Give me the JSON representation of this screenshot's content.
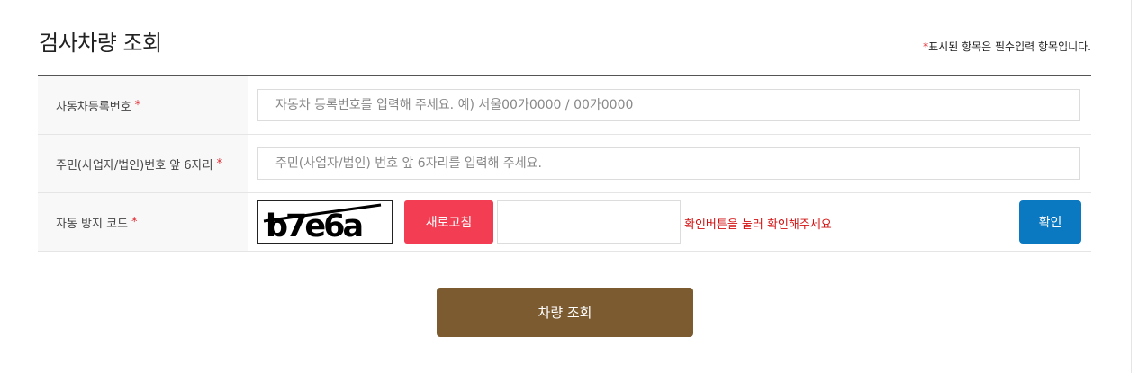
{
  "page": {
    "title": "검사차량 조회",
    "required_note_star": "*",
    "required_note": "표시된 항목은 필수입력 항목입니다."
  },
  "form": {
    "required_star": "*",
    "plate": {
      "label": "자동차등록번호",
      "placeholder": "자동차 등록번호를 입력해 주세요. 예) 서울00가0000 / 00가0000",
      "value": ""
    },
    "id_number": {
      "label": "주민(사업자/법인)번호 앞 6자리",
      "placeholder": "주민(사업자/법인) 번호 앞 6자리를 입력해 주세요.",
      "value": ""
    },
    "captcha": {
      "label": "자동 방지 코드",
      "code_image_text": "b7e6a",
      "refresh_label": "새로고침",
      "input_value": "",
      "message": "확인버튼을 눌러 확인해주세요",
      "confirm_label": "확인"
    }
  },
  "actions": {
    "search_label": "차량 조회"
  },
  "colors": {
    "required": "#e0262d",
    "refresh_button": "#f23d52",
    "confirm_button": "#0a79c2",
    "search_button": "#7d5b30",
    "message": "#d31111"
  }
}
